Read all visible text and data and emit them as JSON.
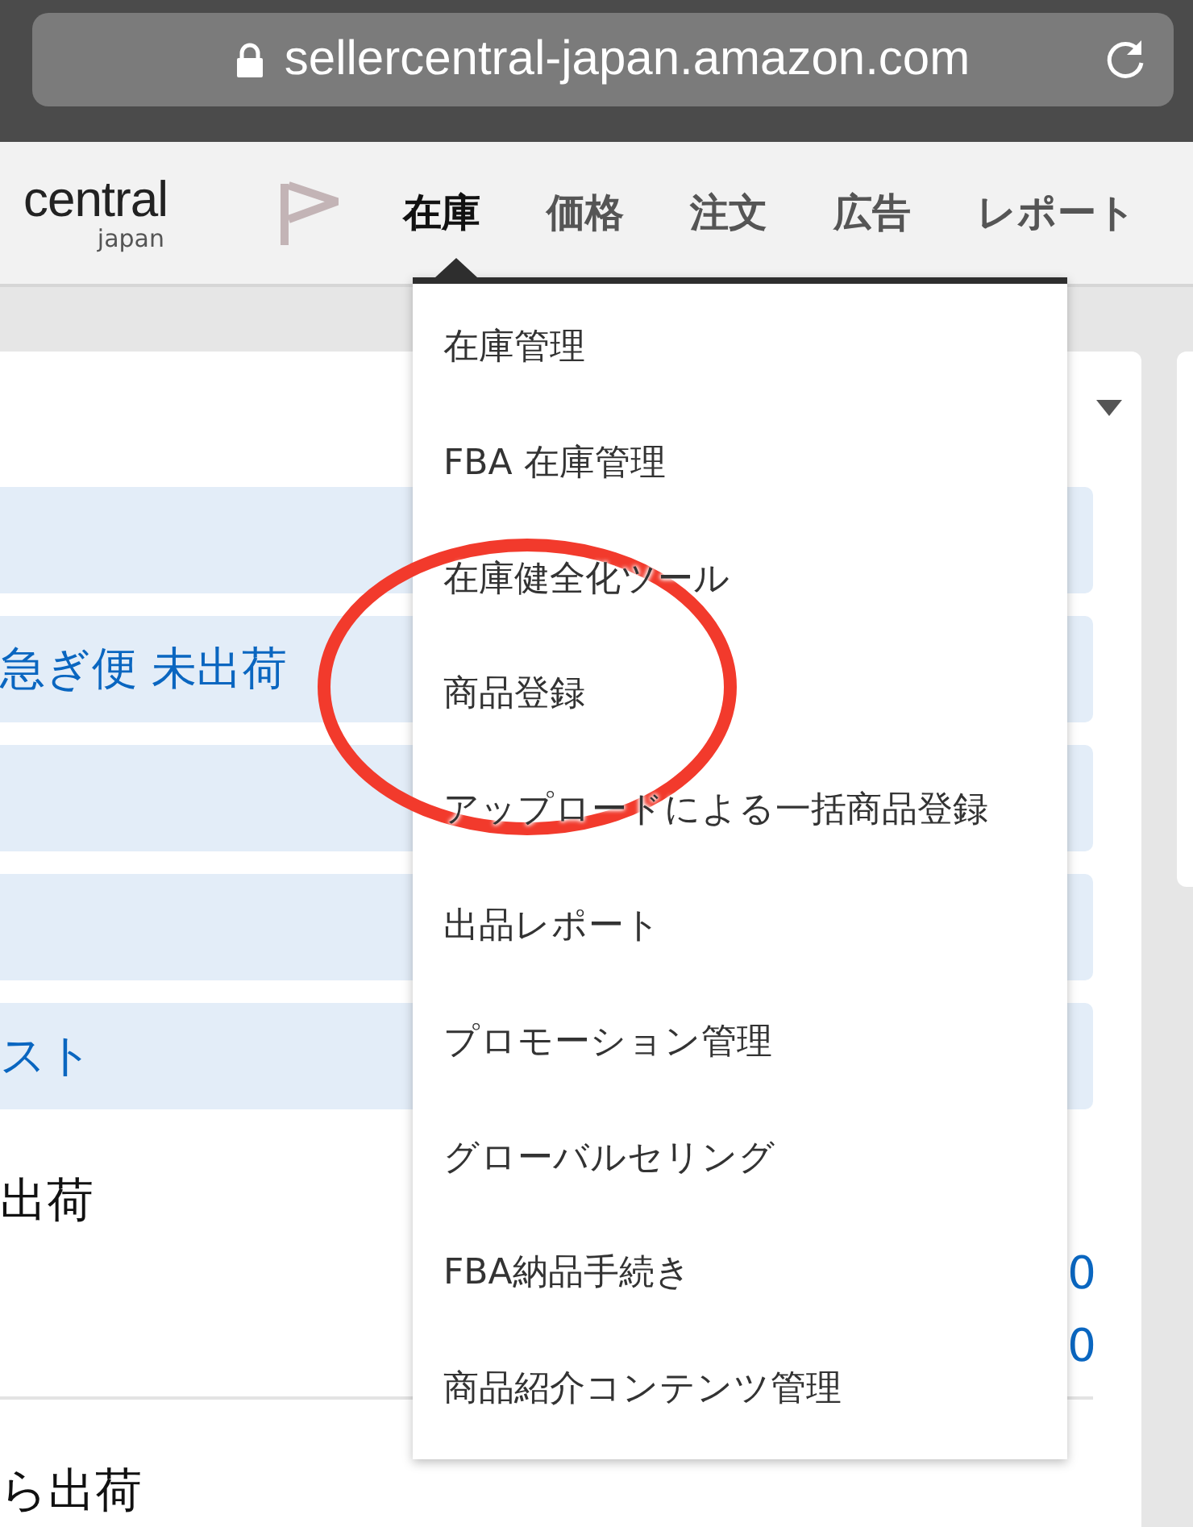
{
  "browser": {
    "url": "sellercentral-japan.amazon.com"
  },
  "header": {
    "logo_text": "central",
    "logo_sub": "japan",
    "nav": [
      {
        "label": "在庫",
        "selected": true
      },
      {
        "label": "価格",
        "selected": false
      },
      {
        "label": "注文",
        "selected": false
      },
      {
        "label": "広告",
        "selected": false
      },
      {
        "label": "レポート",
        "selected": false
      }
    ]
  },
  "dropdown": {
    "items": [
      "在庫管理",
      "FBA 在庫管理",
      "在庫健全化ツール",
      "商品登録",
      "アップロードによる一括商品登録",
      "出品レポート",
      "プロモーション管理",
      "グローバルセリング",
      "FBA納品手続き",
      "商品紹介コンテンツ管理"
    ]
  },
  "card": {
    "links": [
      {
        "kind": "blank"
      },
      {
        "kind": "link",
        "label": "急ぎ便 未出荷"
      },
      {
        "kind": "blank"
      },
      {
        "kind": "blank"
      },
      {
        "kind": "link",
        "label": "スト"
      }
    ],
    "sections": [
      {
        "heading": "出荷",
        "values": [
          "0",
          "0"
        ]
      },
      {
        "heading": "ら出荷"
      }
    ]
  }
}
